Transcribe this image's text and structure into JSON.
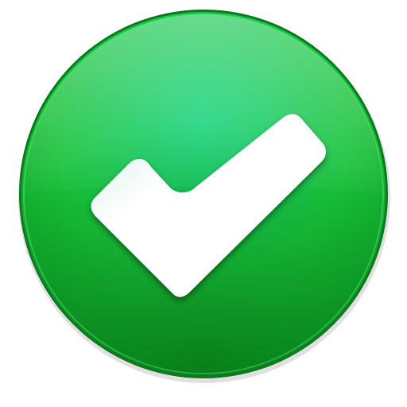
{
  "icon": {
    "name": "checkmark-icon",
    "kind": "success confirmation badge",
    "colors": {
      "background": "#ffffff",
      "outer_rim": "#0c7a1c",
      "green_light": "#12d27a",
      "green_mid": "#18c23a",
      "green_dark": "#0a8f1e",
      "check_fill": "#ffffff",
      "check_shade": "#d8f0ea"
    }
  }
}
